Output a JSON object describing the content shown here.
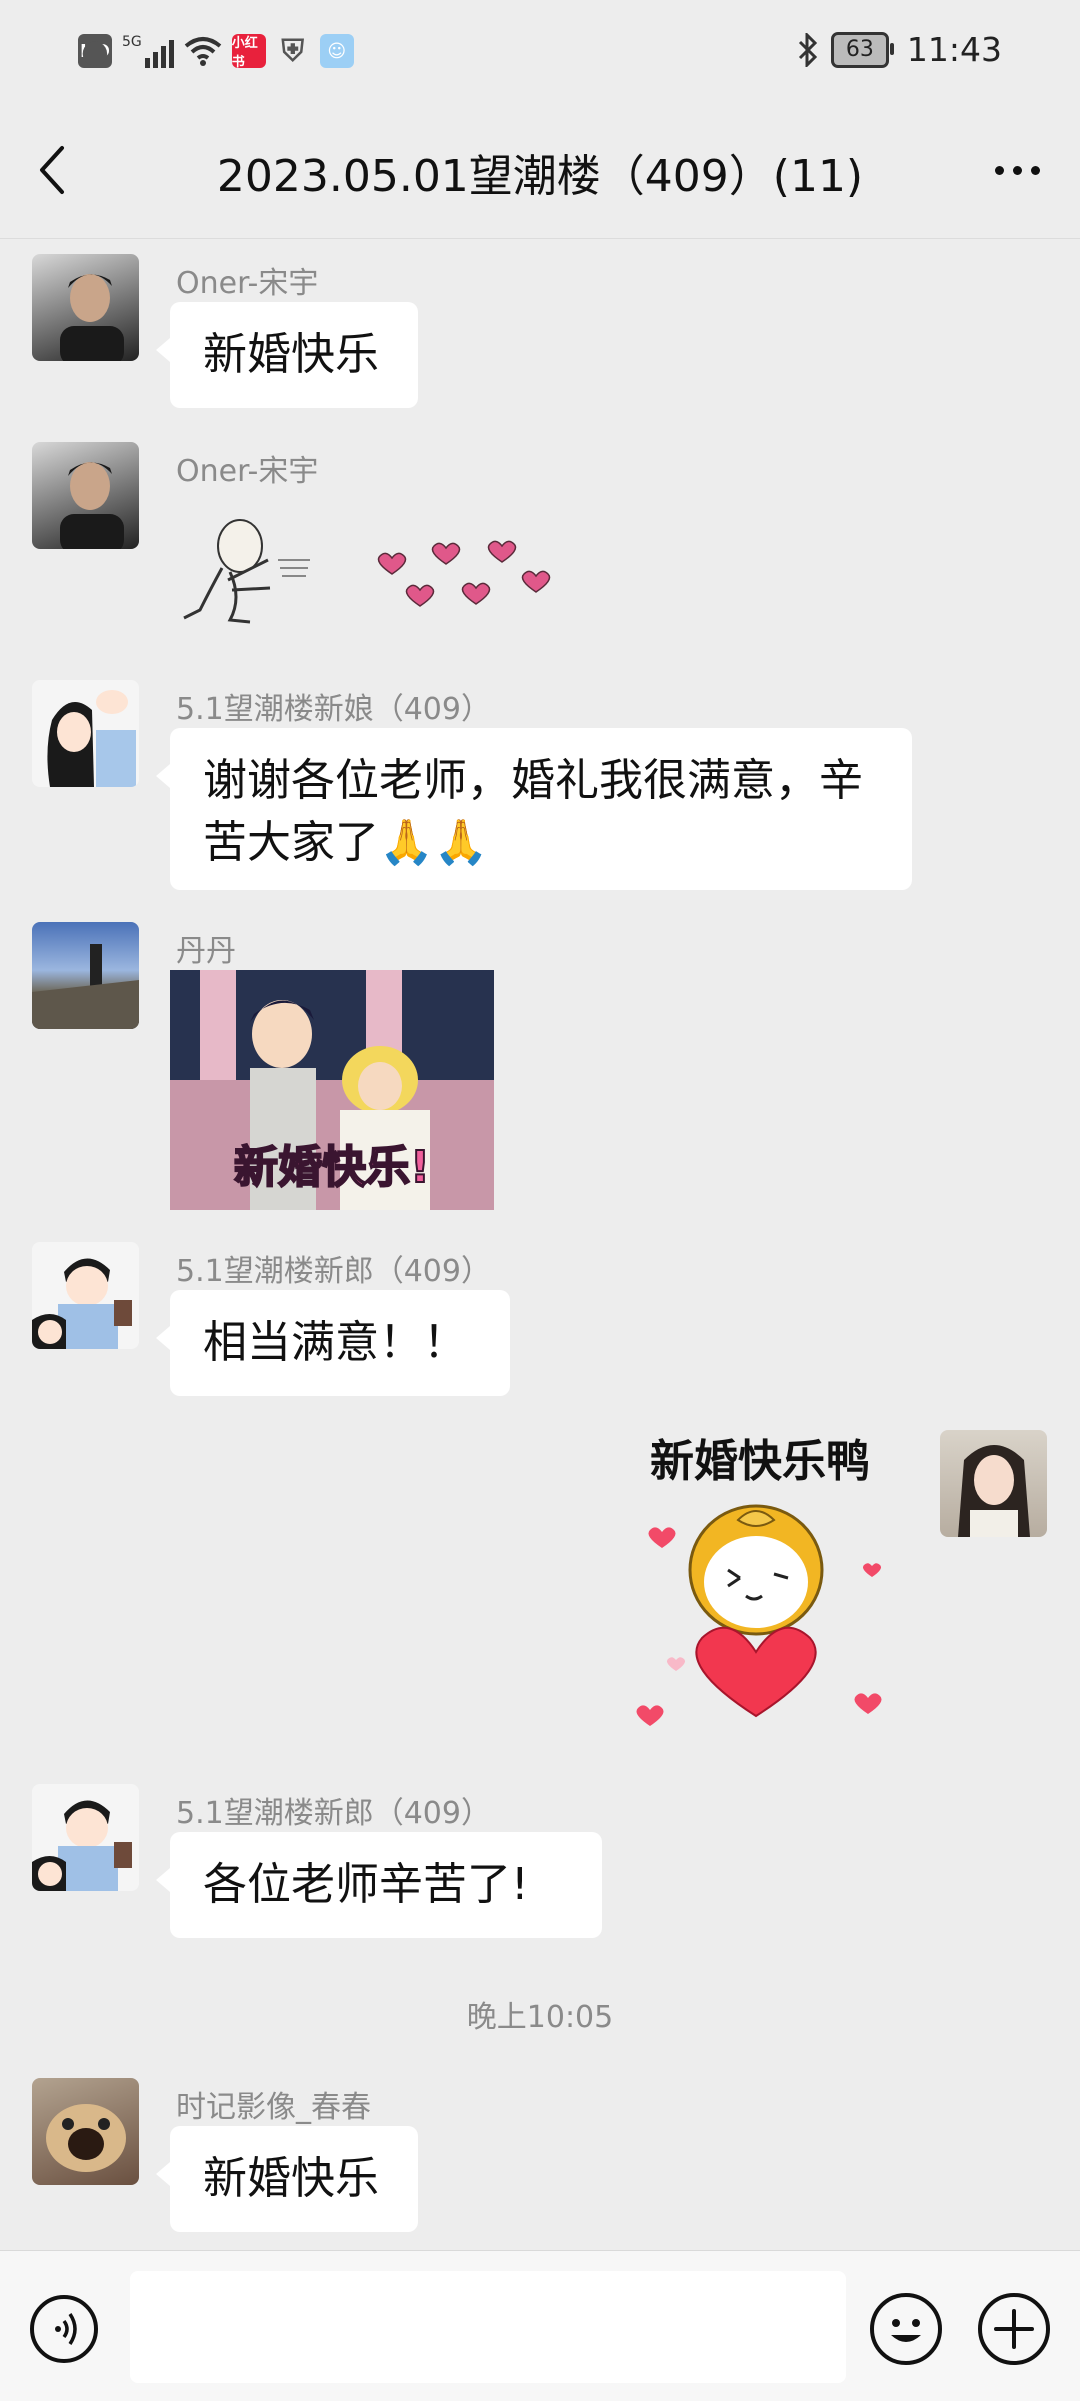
{
  "status_bar": {
    "hd": "HD",
    "network": "5G",
    "app_badge": "小红书",
    "battery": "63",
    "time": "11:43"
  },
  "header": {
    "title": "2023.05.01望潮楼（409）(11)"
  },
  "messages": [
    {
      "sender": "Oner-宋宇",
      "text": "新婚快乐"
    },
    {
      "sender": "Oner-宋宇",
      "sticker": "running-man-hearts"
    },
    {
      "sender": "5.1望潮楼新娘（409）",
      "text_line1": "谢谢各位老师，婚礼我很满意，辛",
      "text_line2": "苦大家了🙏🙏"
    },
    {
      "sender": "丹丹",
      "image_caption": "新婚快乐!"
    },
    {
      "sender": "5.1望潮楼新郎（409）",
      "text": "相当满意！！"
    },
    {
      "sender": "self",
      "sticker_caption": "新婚快乐鸭"
    },
    {
      "sender": "5.1望潮楼新郎（409）",
      "text": "各位老师辛苦了!"
    },
    {
      "time": "晚上10:05"
    },
    {
      "sender": "时记影像_春春",
      "text": "新婚快乐"
    }
  ],
  "input_bar": {
    "placeholder": ""
  },
  "colors": {
    "background": "#ededed",
    "bubble": "#ffffff",
    "sender_text": "#8a8a8a"
  }
}
